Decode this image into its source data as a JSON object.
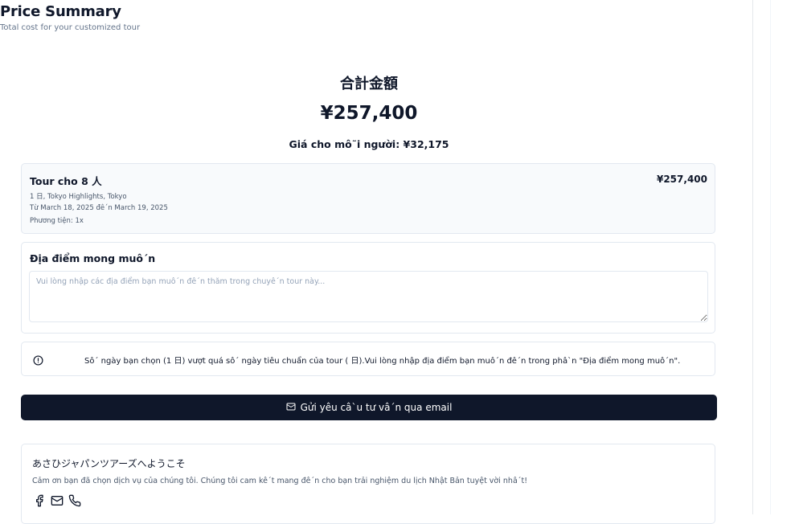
{
  "header": {
    "title": "Price Summary",
    "subtitle": "Total cost for your customized tour"
  },
  "total": {
    "label": "合計金額",
    "amount": "¥257,400",
    "per_person": "Giá cho mô˜i người: ¥32,175"
  },
  "tour": {
    "title": "Tour cho 8 人",
    "price": "¥257,400",
    "line1": "1 日, Tokyo Highlights, Tokyo",
    "line2": "Từ March 18, 2025 đê´n March 19, 2025",
    "line3": "Phương tiện: 1x"
  },
  "destination": {
    "title": "Địa điểm mong muô´n",
    "placeholder": "Vui lòng nhập các địa điểm bạn muô´n đê´n thăm trong chuyê´n tour này..."
  },
  "alert": {
    "text": "Sô´ ngày bạn chọn (1 日) vượt quá sô´ ngày tiêu chuẩn của tour ( 日).Vui lòng nhập địa điểm bạn muô´n đê´n trong phâ`n \"Địa điểm mong muô´n\"."
  },
  "email_button": {
    "label": "Gửi yêu câ`u tư vâ´n qua email"
  },
  "welcome": {
    "title": "あさひジャパンツアーズへようこそ",
    "text": "Cảm ơn bạn đã chọn dịch vụ của chúng tôi. Chúng tôi cam kê´t mang đê´n cho bạn trải nghiệm du lịch Nhật Bản tuyệt vời nhâ´t!"
  },
  "icons": {
    "alert": "alert-circle-icon",
    "mail": "mail-icon",
    "facebook": "facebook-icon",
    "phone": "phone-icon"
  },
  "colors": {
    "primary": "#0f172a",
    "border": "#e2e8f0",
    "muted": "#64748b"
  }
}
